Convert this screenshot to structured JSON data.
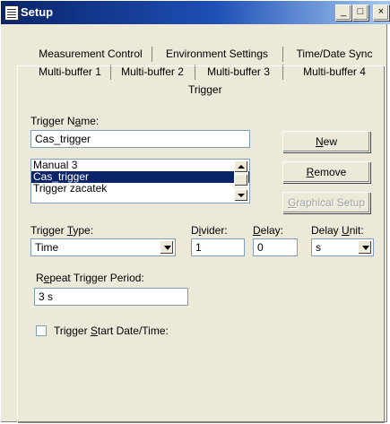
{
  "window": {
    "title": "Setup",
    "minimize_glyph": "_",
    "maximize_glyph": "□",
    "close_glyph": "×"
  },
  "tabs": {
    "row1": [
      "Measurement Control",
      "Environment Settings",
      "Time/Date Sync"
    ],
    "row2": [
      "Multi-buffer 1",
      "Multi-buffer 2",
      "Multi-buffer 3",
      "Multi-buffer 4"
    ],
    "active": "Trigger"
  },
  "form": {
    "trigger_name_label": {
      "pre": "Trigger N",
      "key": "a",
      "post": "me:"
    },
    "trigger_name_value": "Cas_trigger",
    "trigger_list": [
      "Manual 3",
      "Cas_trigger",
      "Trigger zacatek"
    ],
    "trigger_list_selected": "Cas_trigger",
    "new_button": {
      "pre": "",
      "key": "N",
      "post": "ew"
    },
    "remove_button": {
      "pre": "",
      "key": "R",
      "post": "emove"
    },
    "graphical_setup_button": {
      "pre": "",
      "key": "G",
      "post": "raphical Setup"
    },
    "trigger_type_label": {
      "pre": "Trigger ",
      "key": "T",
      "post": "ype:"
    },
    "trigger_type_value": "Time",
    "divider_label": {
      "pre": "D",
      "key": "i",
      "post": "vider:"
    },
    "divider_value": "1",
    "delay_label": {
      "pre": "",
      "key": "D",
      "post": "elay:"
    },
    "delay_value": "0",
    "delay_unit_label": {
      "pre": "Delay ",
      "key": "U",
      "post": "nit:"
    },
    "delay_unit_value": "s",
    "repeat_label": {
      "pre": "R",
      "key": "e",
      "post": "peat Trigger Period:"
    },
    "repeat_value": "3 s",
    "start_date_label": {
      "pre": "Trigger ",
      "key": "S",
      "post": "tart Date/Time:"
    },
    "start_date_checked": false
  },
  "colors": {
    "face": "#ece9d8",
    "selection": "#0a246a",
    "title_gradient_start": "#0a246a"
  }
}
